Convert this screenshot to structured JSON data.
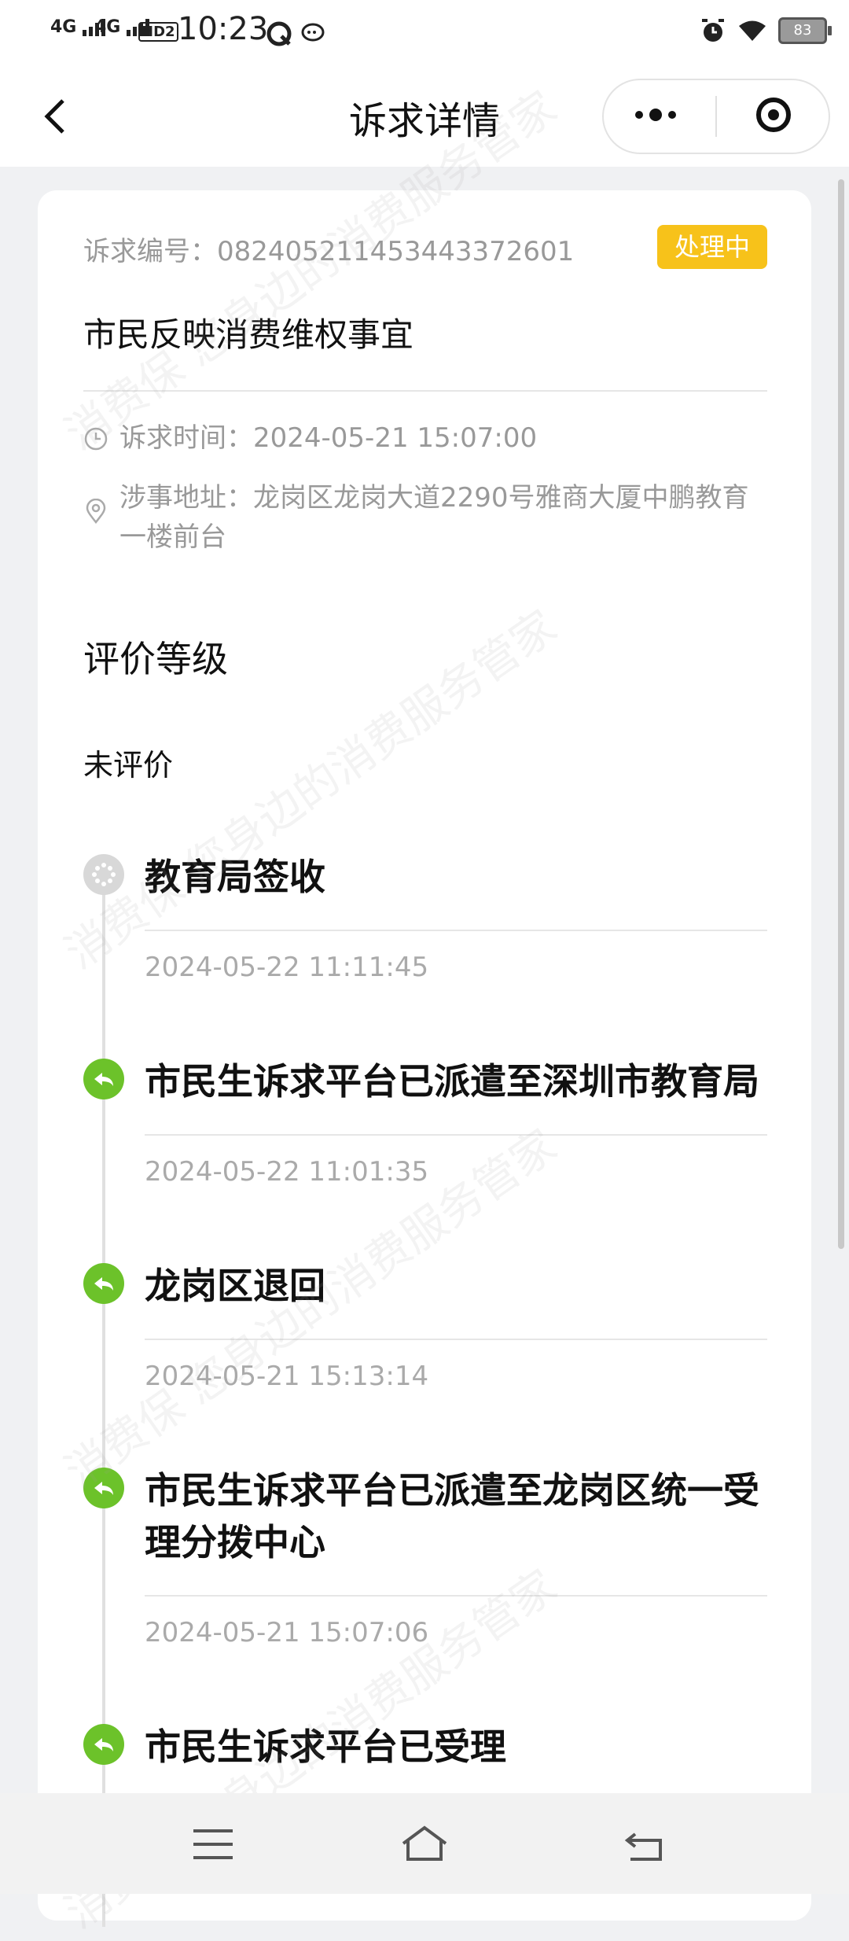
{
  "status_bar": {
    "signal1": "4G",
    "signal2": "4G",
    "hd": "HD2",
    "time": "10:23",
    "battery": "83"
  },
  "nav": {
    "title": "诉求详情"
  },
  "detail": {
    "number_label": "诉求编号：",
    "number_value": "082405211453443372601",
    "status_badge": "处理中",
    "title": "市民反映消费维权事宜",
    "time_label": "诉求时间：",
    "time_value": "2024-05-21 15:07:00",
    "address_label": "涉事地址：",
    "address_value": "龙岗区龙岗大道2290号雅商大厦中鹏教育一楼前台"
  },
  "rating": {
    "title": "评价等级",
    "value": "未评价"
  },
  "timeline": [
    {
      "title": "教育局签收",
      "time": "2024-05-22 11:11:45",
      "state": "pending"
    },
    {
      "title": "市民生诉求平台已派遣至深圳市教育局",
      "time": "2024-05-22 11:01:35",
      "state": "done"
    },
    {
      "title": "龙岗区退回",
      "time": "2024-05-21 15:13:14",
      "state": "done"
    },
    {
      "title": "市民生诉求平台已派遣至龙岗区统一受理分拨中心",
      "time": "2024-05-21 15:07:06",
      "state": "done"
    },
    {
      "title": "市民生诉求平台已受理",
      "time": "",
      "state": "done"
    }
  ],
  "watermark": "消费保 您身边的消费服务管家",
  "colors": {
    "badge": "#f7c21a",
    "timeline_done": "#6cc22a",
    "timeline_pending": "#d8d8d8"
  },
  "icons": {
    "back": "chevron-left-icon",
    "more": "more-dots-icon",
    "target": "target-icon",
    "clock": "clock-icon",
    "location": "location-pin-icon",
    "menu": "menu-icon",
    "home": "home-icon",
    "return": "back-arrow-icon"
  }
}
